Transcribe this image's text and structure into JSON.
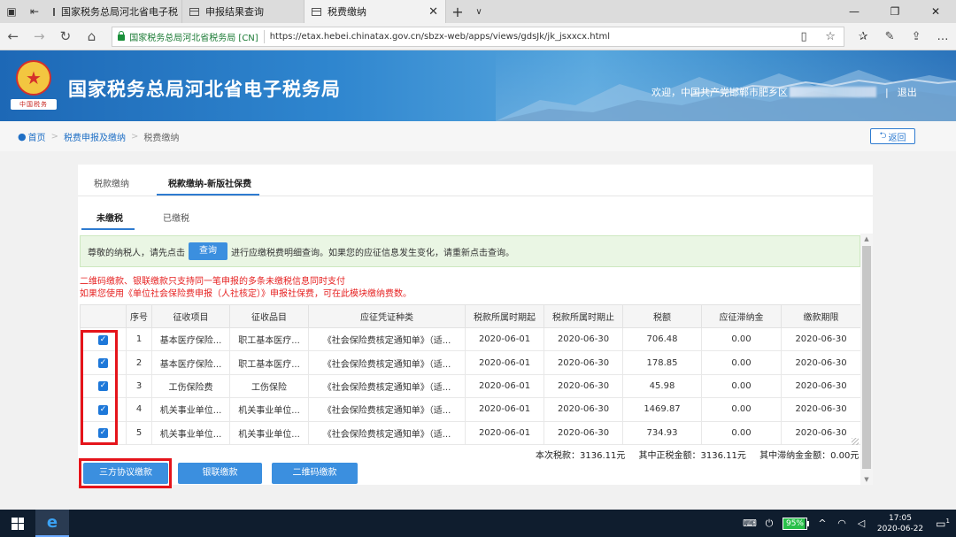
{
  "browser": {
    "tabs": [
      {
        "label": "国家税务总局河北省电子税"
      },
      {
        "label": "申报结果查询"
      },
      {
        "label": "税费缴纳",
        "active": true
      }
    ],
    "url_site": "国家税务总局河北省税务局 [CN]",
    "url": "https://etax.hebei.chinatax.gov.cn/sbzx-web/apps/views/gdsJk/jk_jsxxcx.html"
  },
  "site": {
    "emblem_text": "中国税务",
    "title": "国家税务总局河北省电子税务局",
    "welcome": "欢迎，中国共产党邯郸市肥乡区",
    "logout": "退出",
    "separator": "|"
  },
  "breadcrumb": {
    "home": "首页",
    "level1": "税费申报及缴纳",
    "level2": "税费缴纳",
    "back": "返回"
  },
  "tabs_primary": [
    "税款缴纳",
    "税款缴纳-新版社保费"
  ],
  "tabs_secondary": [
    "未缴税",
    "已缴税"
  ],
  "notice": {
    "before": "尊敬的纳税人，请先点击",
    "button": "查询",
    "after": "进行应缴税费明细查询。如果您的应征信息发生变化，请重新点击查询。"
  },
  "tips": [
    "二维码缴款、银联缴款只支持同一笔申报的多条未缴税信息同时支付",
    "如果您使用《单位社会保险费申报（人社核定）》申报社保费，可在此模块缴纳费数。"
  ],
  "table": {
    "headers": [
      "",
      "序号",
      "征收项目",
      "征收品目",
      "应征凭证种类",
      "税款所属时期起",
      "税款所属时期止",
      "税额",
      "应征滞纳金",
      "缴款期限"
    ],
    "rows": [
      {
        "no": "1",
        "item": "基本医疗保险...",
        "sub": "职工基本医疗...",
        "voucher": "《社会保险费核定通知单》（适...",
        "start": "2020-06-01",
        "end": "2020-06-30",
        "amount": "706.48",
        "late": "0.00",
        "deadline": "2020-06-30"
      },
      {
        "no": "2",
        "item": "基本医疗保险...",
        "sub": "职工基本医疗...",
        "voucher": "《社会保险费核定通知单》（适...",
        "start": "2020-06-01",
        "end": "2020-06-30",
        "amount": "178.85",
        "late": "0.00",
        "deadline": "2020-06-30"
      },
      {
        "no": "3",
        "item": "工伤保险费",
        "sub": "工伤保险",
        "voucher": "《社会保险费核定通知单》（适...",
        "start": "2020-06-01",
        "end": "2020-06-30",
        "amount": "45.98",
        "late": "0.00",
        "deadline": "2020-06-30"
      },
      {
        "no": "4",
        "item": "机关事业单位...",
        "sub": "机关事业单位...",
        "voucher": "《社会保险费核定通知单》（适...",
        "start": "2020-06-01",
        "end": "2020-06-30",
        "amount": "1469.87",
        "late": "0.00",
        "deadline": "2020-06-30"
      },
      {
        "no": "5",
        "item": "机关事业单位...",
        "sub": "机关事业单位...",
        "voucher": "《社会保险费核定通知单》（适...",
        "start": "2020-06-01",
        "end": "2020-06-30",
        "amount": "734.93",
        "late": "0.00",
        "deadline": "2020-06-30"
      }
    ]
  },
  "totals": {
    "this_tax": "本次税款：3136.11元",
    "principal": "其中正税金额：3136.11元",
    "late_fee": "其中滞纳金金额：0.00元"
  },
  "buttons": {
    "tripartite": "三方协议缴款",
    "unionpay": "银联缴款",
    "qrcode": "二维码缴款"
  },
  "taskbar": {
    "battery": "95%",
    "time": "17:05",
    "date": "2020-06-22",
    "notif_count": "1"
  },
  "colors": {
    "accent": "#3b8fdf",
    "highlight": "#e5141b",
    "notice_bg": "#eaf6e4"
  }
}
